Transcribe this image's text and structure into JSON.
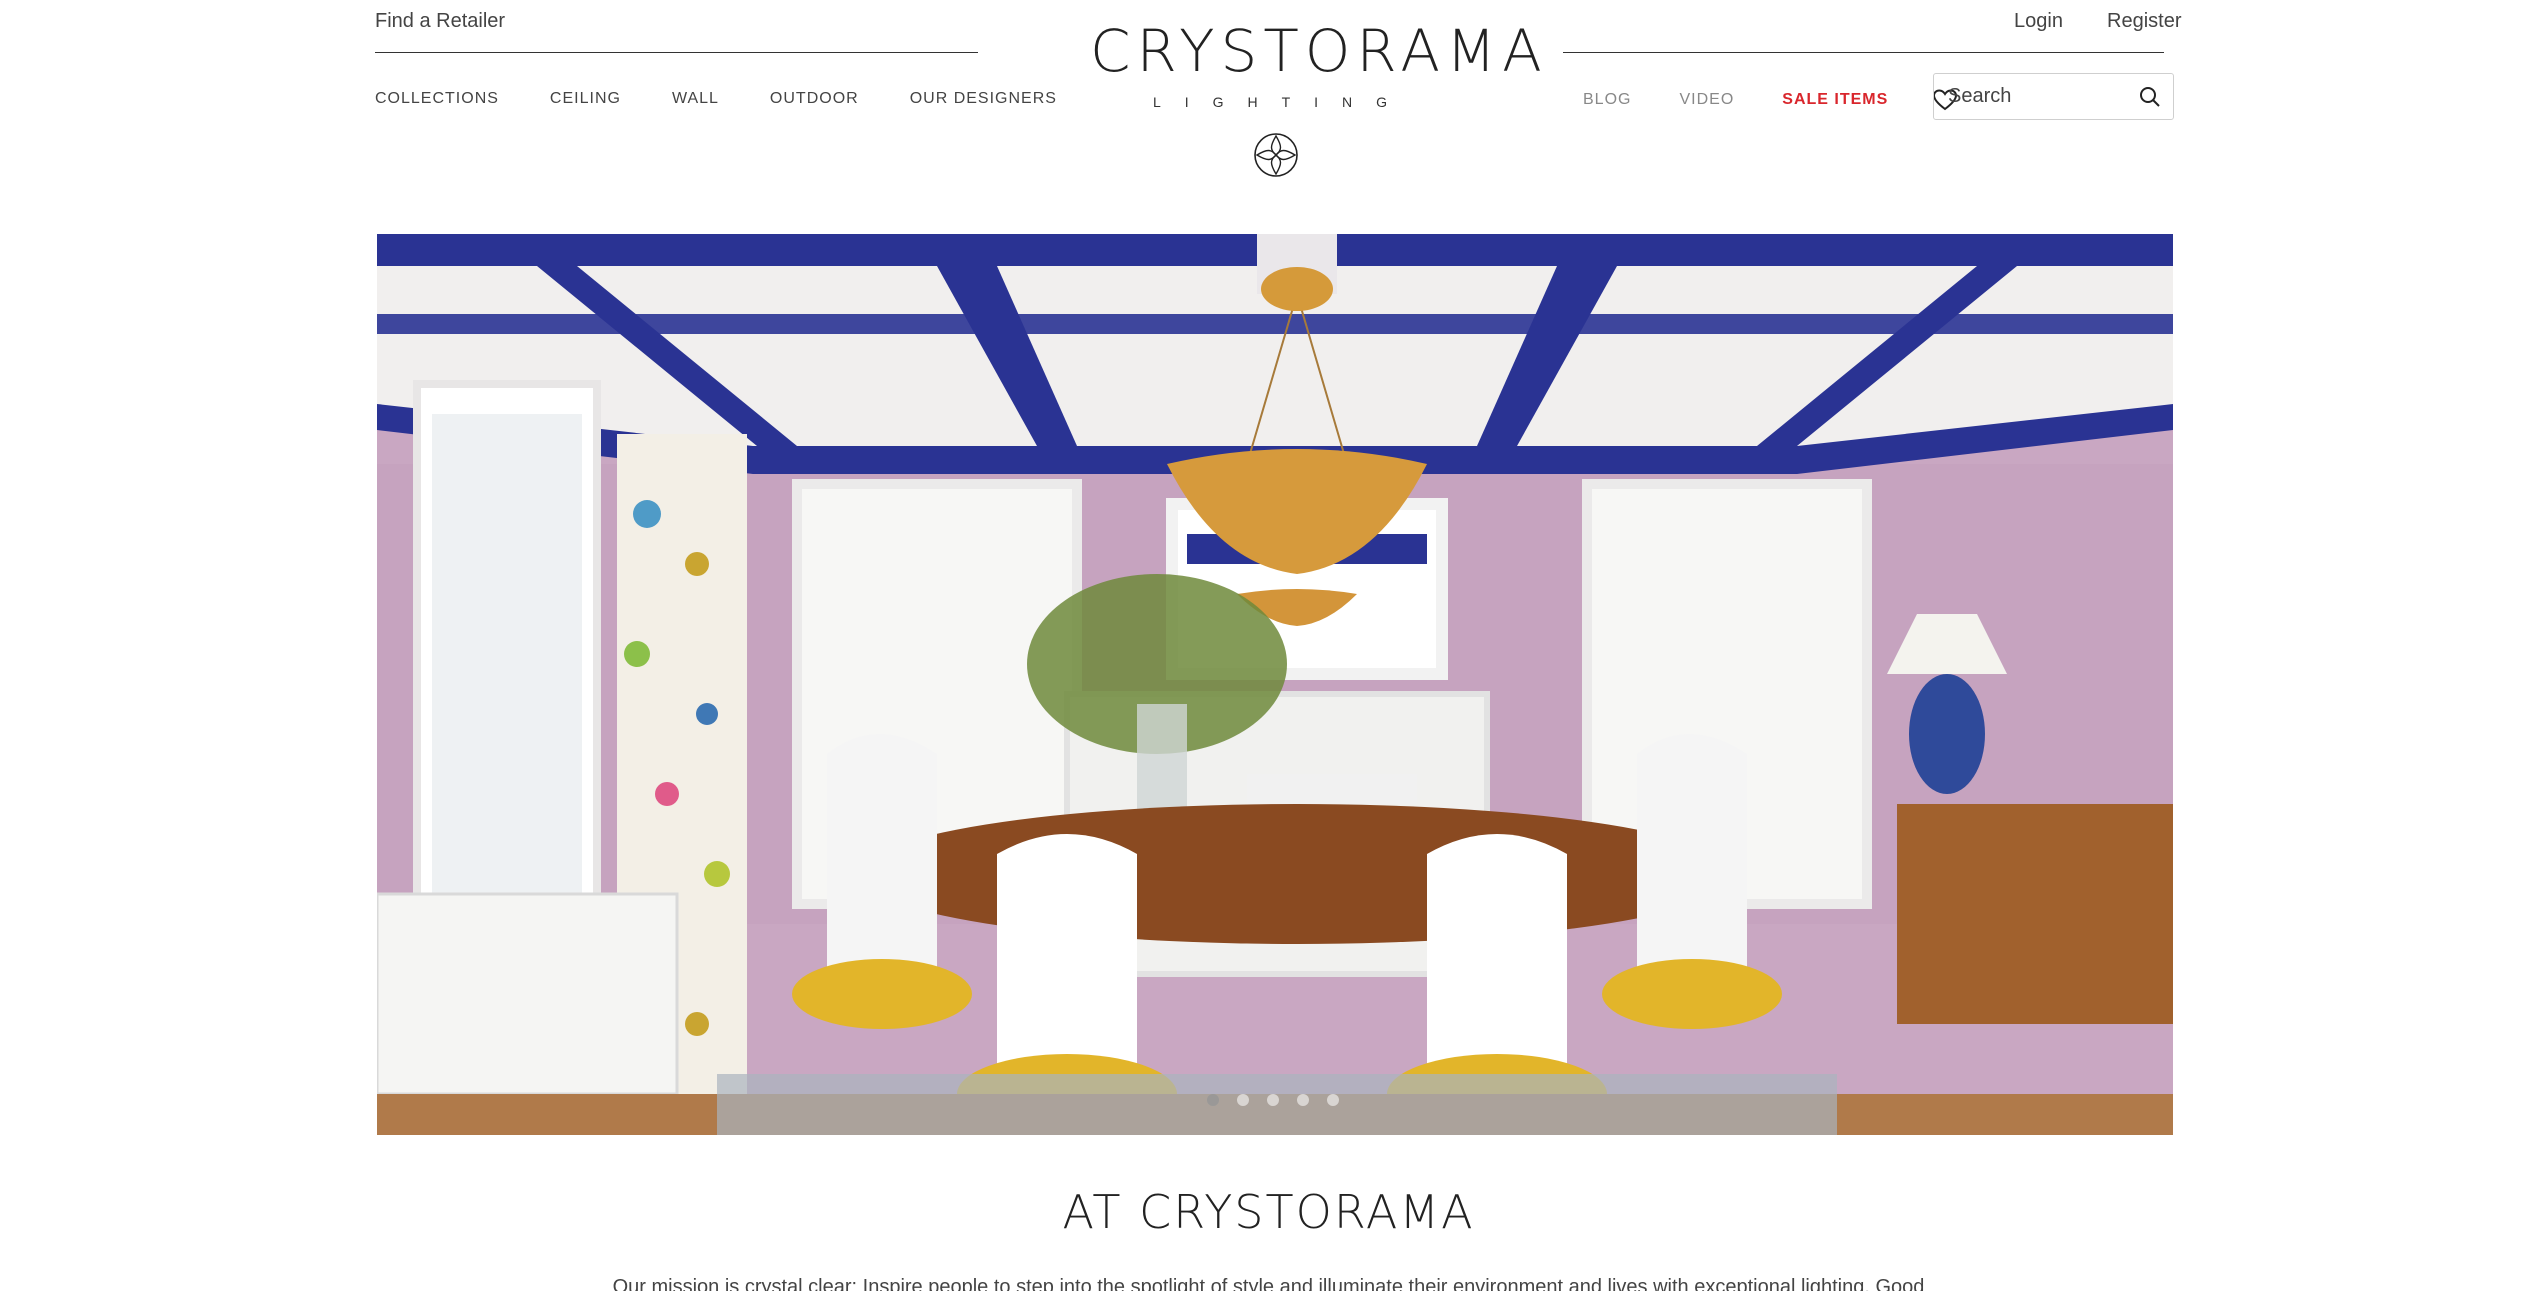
{
  "header": {
    "find_retailer": "Find a Retailer",
    "login": "Login",
    "register": "Register",
    "logo_word": "CRYSTORAMA",
    "logo_sub": "LIGHTING"
  },
  "nav_left": [
    "COLLECTIONS",
    "CEILING",
    "WALL",
    "OUTDOOR",
    "OUR DESIGNERS"
  ],
  "nav_right": {
    "blog": "BLOG",
    "video": "VIDEO",
    "sale": "SALE ITEMS"
  },
  "search": {
    "placeholder": "Search"
  },
  "hero": {
    "slides": 5,
    "active_slide": 1
  },
  "content": {
    "title": "AT CRYSTORAMA",
    "mission": "Our mission is crystal clear:  Inspire people to step into the spotlight of style and illuminate their environment and lives with exceptional lighting.  Good"
  },
  "colors": {
    "accent_sale": "#d9262c",
    "ceiling_blue": "#2a3393",
    "wall_lavender": "#c9a7c2",
    "chair_yellow": "#e2b52a"
  }
}
